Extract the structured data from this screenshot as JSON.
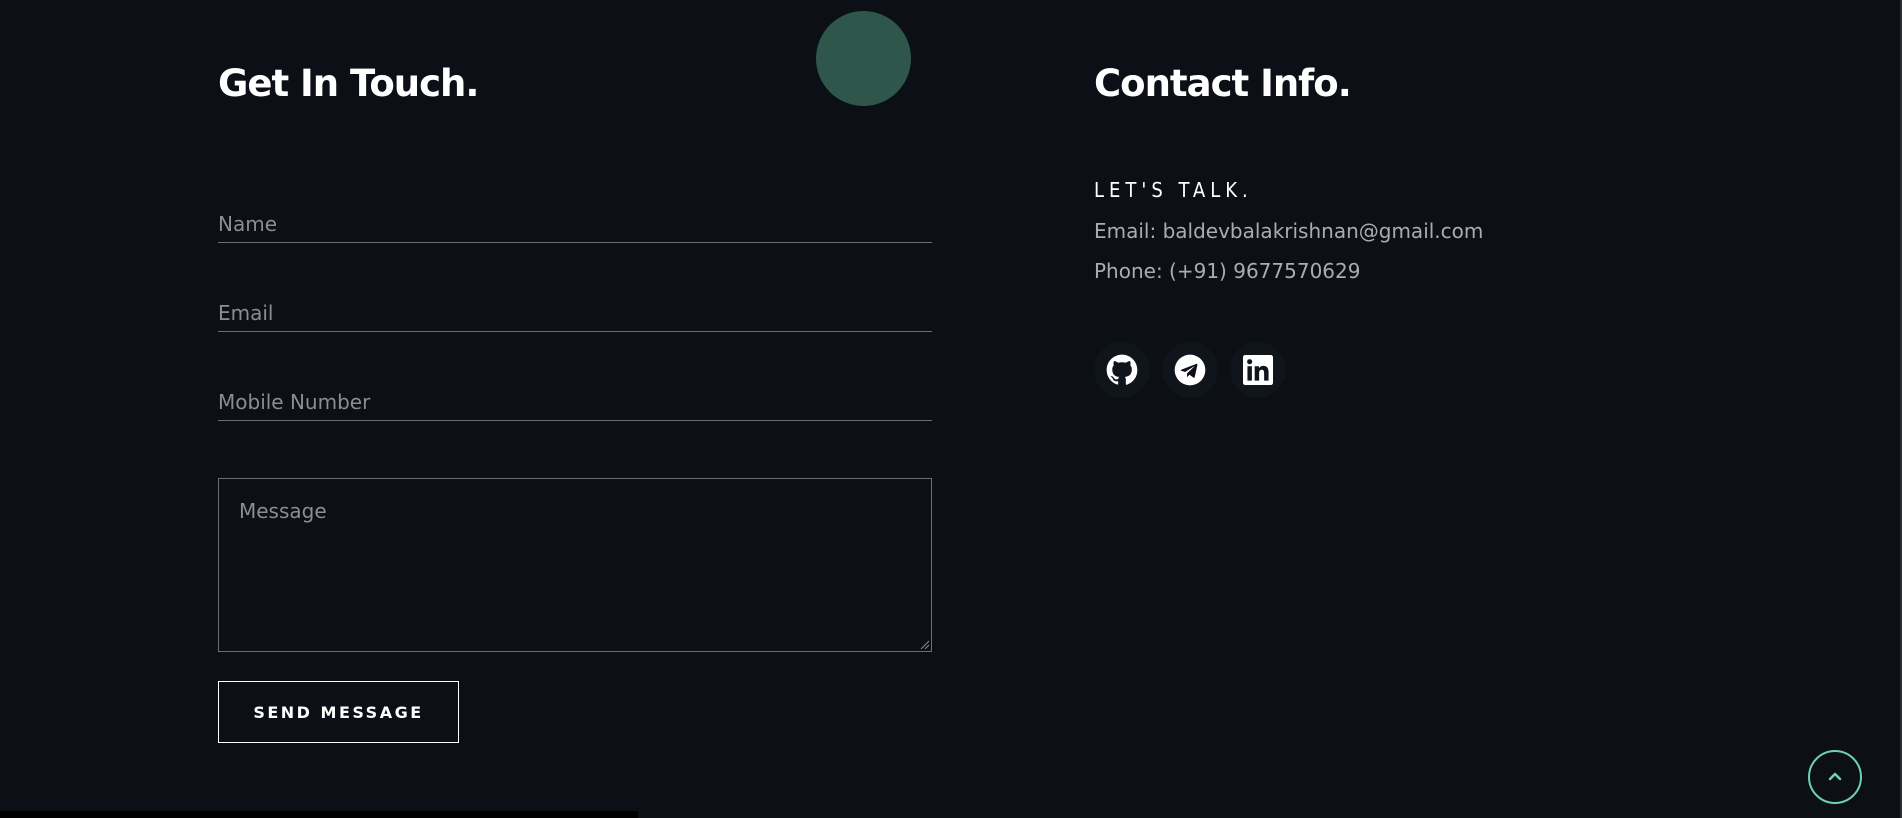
{
  "form": {
    "title": "Get In Touch.",
    "name_placeholder": "Name",
    "email_placeholder": "Email",
    "mobile_placeholder": "Mobile Number",
    "message_placeholder": "Message",
    "submit_label": "SEND MESSAGE"
  },
  "contact": {
    "title": "Contact Info.",
    "subheading": "LET'S TALK.",
    "email_line": "Email: baldevbalakrishnan@gmail.com",
    "phone_line": "Phone: (+91) 9677570629",
    "social": [
      {
        "icon": "github-icon"
      },
      {
        "icon": "telegram-icon"
      },
      {
        "icon": "linkedin-icon"
      }
    ]
  },
  "colors": {
    "background": "#0c0f16",
    "accent": "#6fd0b3",
    "decor_circle": "#2e564b",
    "muted_text": "#a9acb1"
  },
  "back_to_top": {
    "icon": "chevron-up-icon"
  }
}
